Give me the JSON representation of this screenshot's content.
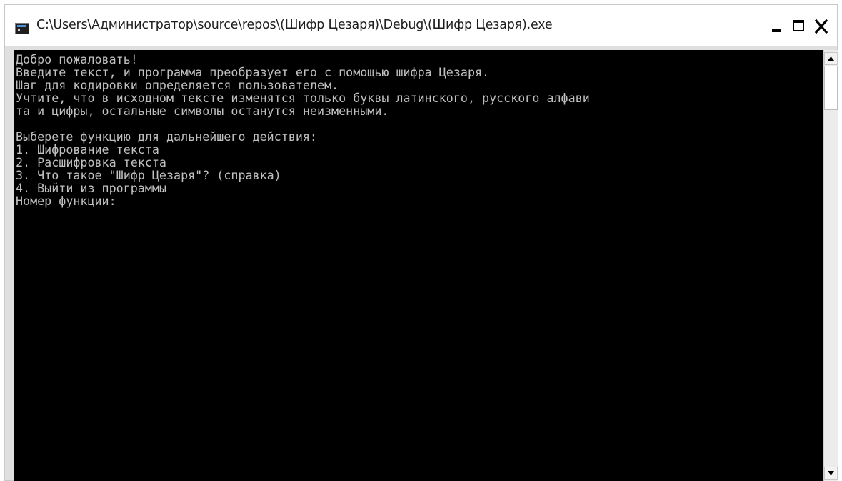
{
  "window": {
    "title": "C:\\Users\\Администратор\\source\\repos\\(Шифр Цезаря)\\Debug\\(Шифр Цезаря).exe",
    "icon": "console-app-icon",
    "controls": {
      "minimize_icon": "minimize-icon",
      "maximize_icon": "maximize-icon",
      "close_icon": "close-icon"
    }
  },
  "console": {
    "background": "#000000",
    "text_color": "#c0c0c0",
    "lines": [
      "Добро пожаловать!",
      "Введите текст, и программа преобразует его с помощью шифра Цезаря.",
      "Шаг для кодировки определяется пользователем.",
      "Учтите, что в исходном тексте изменятся только буквы латинского, русского алфави",
      "та и цифры, остальные символы останутся неизменными.",
      "",
      "Выберете функцию для дальнейшего действия:",
      "1. Шифрование текста",
      "2. Расшифровка текста",
      "3. Что такое \"Шифр Цезаря\"? (справка)",
      "4. Выйти из программы",
      "Номер функции:"
    ]
  },
  "scrollbar": {
    "up_icon": "scroll-up-arrow-icon",
    "down_icon": "scroll-down-arrow-icon"
  }
}
